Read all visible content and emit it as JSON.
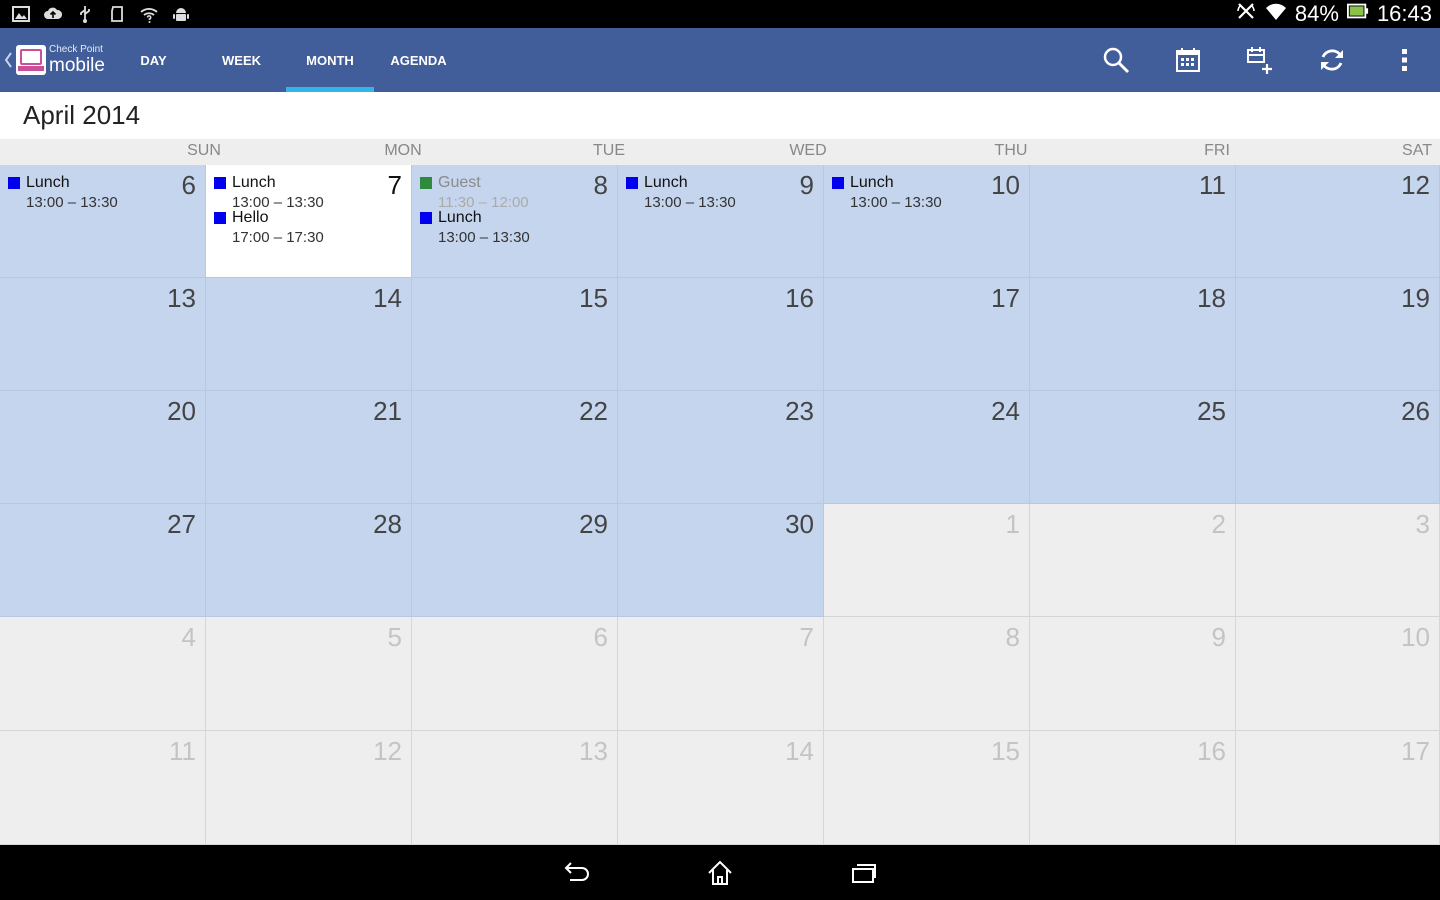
{
  "status_bar": {
    "left_icons": [
      "gallery-icon",
      "cloud-icon",
      "usb-icon",
      "sd-card-icon",
      "wifi-question-icon",
      "android-icon"
    ],
    "battery": "84%",
    "time": "16:43"
  },
  "action_bar": {
    "brand_top": "Check Point",
    "brand_bottom": "mobile",
    "tabs": [
      {
        "label": "DAY"
      },
      {
        "label": "WEEK"
      },
      {
        "label": "MONTH"
      },
      {
        "label": "AGENDA"
      }
    ],
    "active_tab": "MONTH",
    "accent_color": "#33b5e5",
    "bar_color": "#415d9a",
    "actions": [
      "search-icon",
      "calendar-today-icon",
      "new-event-icon",
      "refresh-icon",
      "overflow-menu-icon"
    ]
  },
  "month_title": "April 2014",
  "weekdays": [
    "SUN",
    "MON",
    "TUE",
    "WED",
    "THU",
    "FRI",
    "SAT"
  ],
  "weeks": [
    [
      {
        "day": "6",
        "state": "current",
        "events": [
          {
            "title": "Lunch",
            "time": "13:00 – 13:30",
            "color": "#0000ee"
          }
        ]
      },
      {
        "day": "7",
        "state": "today",
        "events": [
          {
            "title": "Lunch",
            "time": "13:00 – 13:30",
            "color": "#0000ee"
          },
          {
            "title": "Hello",
            "time": "17:00 – 17:30",
            "color": "#0000ee"
          }
        ]
      },
      {
        "day": "8",
        "state": "current",
        "events": [
          {
            "title": "Guest",
            "time": "11:30 – 12:00",
            "color": "#2e8b3e",
            "dim": true
          },
          {
            "title": "Lunch",
            "time": "13:00 – 13:30",
            "color": "#0000ee"
          }
        ]
      },
      {
        "day": "9",
        "state": "current",
        "events": [
          {
            "title": "Lunch",
            "time": "13:00 – 13:30",
            "color": "#0000ee"
          }
        ]
      },
      {
        "day": "10",
        "state": "current",
        "events": [
          {
            "title": "Lunch",
            "time": "13:00 – 13:30",
            "color": "#0000ee"
          }
        ]
      },
      {
        "day": "11",
        "state": "current",
        "events": []
      },
      {
        "day": "12",
        "state": "current",
        "events": []
      }
    ],
    [
      {
        "day": "13",
        "state": "current",
        "events": []
      },
      {
        "day": "14",
        "state": "current",
        "events": []
      },
      {
        "day": "15",
        "state": "current",
        "events": []
      },
      {
        "day": "16",
        "state": "current",
        "events": []
      },
      {
        "day": "17",
        "state": "current",
        "events": []
      },
      {
        "day": "18",
        "state": "current",
        "events": []
      },
      {
        "day": "19",
        "state": "current",
        "events": []
      }
    ],
    [
      {
        "day": "20",
        "state": "current",
        "events": []
      },
      {
        "day": "21",
        "state": "current",
        "events": []
      },
      {
        "day": "22",
        "state": "current",
        "events": []
      },
      {
        "day": "23",
        "state": "current",
        "events": []
      },
      {
        "day": "24",
        "state": "current",
        "events": []
      },
      {
        "day": "25",
        "state": "current",
        "events": []
      },
      {
        "day": "26",
        "state": "current",
        "events": []
      }
    ],
    [
      {
        "day": "27",
        "state": "current",
        "events": []
      },
      {
        "day": "28",
        "state": "current",
        "events": []
      },
      {
        "day": "29",
        "state": "current",
        "events": []
      },
      {
        "day": "30",
        "state": "current",
        "events": []
      },
      {
        "day": "1",
        "state": "other",
        "events": []
      },
      {
        "day": "2",
        "state": "other",
        "events": []
      },
      {
        "day": "3",
        "state": "other",
        "events": []
      }
    ],
    [
      {
        "day": "4",
        "state": "other",
        "events": []
      },
      {
        "day": "5",
        "state": "other",
        "events": []
      },
      {
        "day": "6",
        "state": "other",
        "events": []
      },
      {
        "day": "7",
        "state": "other",
        "events": []
      },
      {
        "day": "8",
        "state": "other",
        "events": []
      },
      {
        "day": "9",
        "state": "other",
        "events": []
      },
      {
        "day": "10",
        "state": "other",
        "events": []
      }
    ],
    [
      {
        "day": "11",
        "state": "other",
        "events": []
      },
      {
        "day": "12",
        "state": "other",
        "events": []
      },
      {
        "day": "13",
        "state": "other",
        "events": []
      },
      {
        "day": "14",
        "state": "other",
        "events": []
      },
      {
        "day": "15",
        "state": "other",
        "events": []
      },
      {
        "day": "16",
        "state": "other",
        "events": []
      },
      {
        "day": "17",
        "state": "other",
        "events": []
      }
    ]
  ],
  "nav_bar": {
    "buttons": [
      "back-icon",
      "home-icon",
      "recent-apps-icon"
    ]
  }
}
